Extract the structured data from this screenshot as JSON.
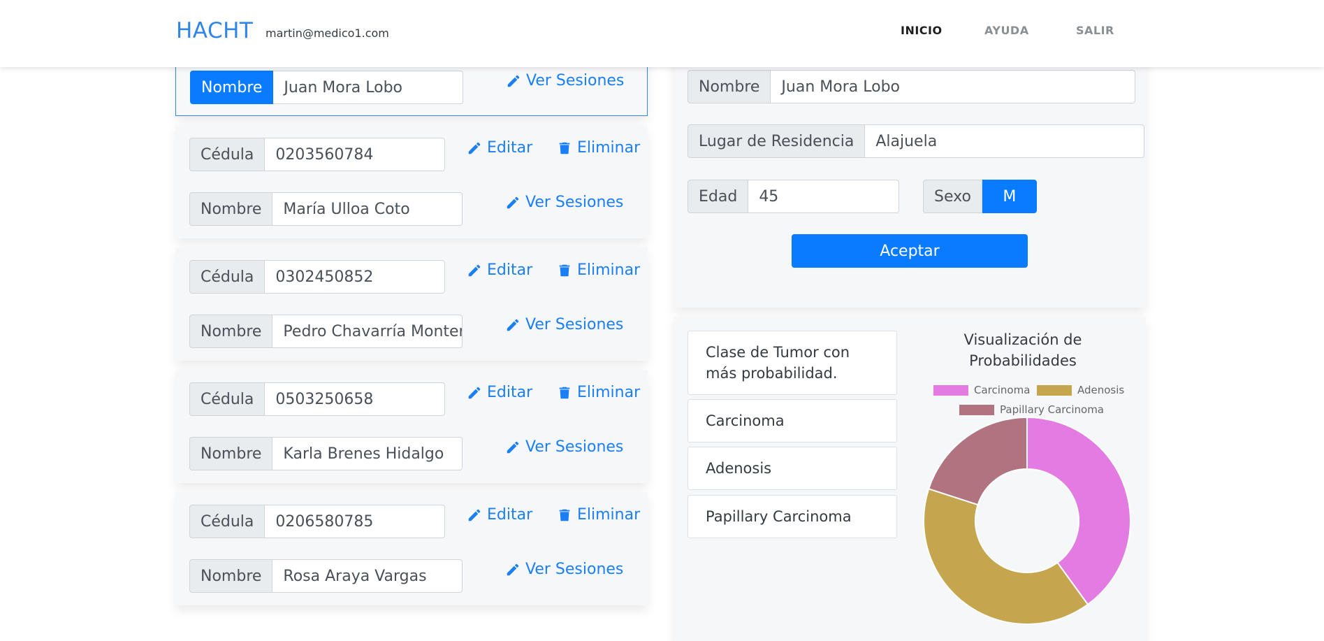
{
  "navbar": {
    "brand": "HACHT",
    "user_email": "martin@medico1.com",
    "links": [
      "INICIO",
      "AYUDA",
      "SALIR"
    ]
  },
  "labels": {
    "cedula": "Cédula",
    "nombre": "Nombre",
    "edit": "Editar",
    "delete": "Eliminar",
    "sessions": "Ver Sesiones"
  },
  "patients_top": {
    "name": "Juan Mora Lobo"
  },
  "patients": [
    {
      "cedula": "0203560784",
      "name": "María Ulloa Coto"
    },
    {
      "cedula": "0302450852",
      "name": "Pedro Chavarría Montero"
    },
    {
      "cedula": "0503250658",
      "name": "Karla Brenes Hidalgo"
    },
    {
      "cedula": "0206580785",
      "name": "Rosa Araya Vargas"
    }
  ],
  "patient_form": {
    "name_label": "Nombre",
    "name_value": "Juan Mora Lobo",
    "residence_label": "Lugar de Residencia",
    "residence_value": "Alajuela",
    "age_label": "Edad",
    "age_value": "45",
    "sex_label": "Sexo",
    "sex_value": "M",
    "accept_label": "Aceptar"
  },
  "tumor_panel": {
    "header": "Clase de Tumor con más probabilidad.",
    "classes": [
      "Carcinoma",
      "Adenosis",
      "Papillary Carcinoma"
    ]
  },
  "icons": {
    "edit": "pencil-icon",
    "delete": "trash-icon"
  },
  "colors": {
    "primary": "#087bff",
    "link": "#1a7ff5",
    "brand": "#2f86e6"
  },
  "chart_data": {
    "type": "pie",
    "title": "Visualización de Probabilidades",
    "legend_position": "top",
    "labels": [
      "Carcinoma",
      "Adenosis",
      "Papillary Carcinoma"
    ],
    "values": [
      40,
      40,
      20
    ],
    "colors": [
      "#e37be3",
      "#c6a54f",
      "#b1737f"
    ]
  }
}
